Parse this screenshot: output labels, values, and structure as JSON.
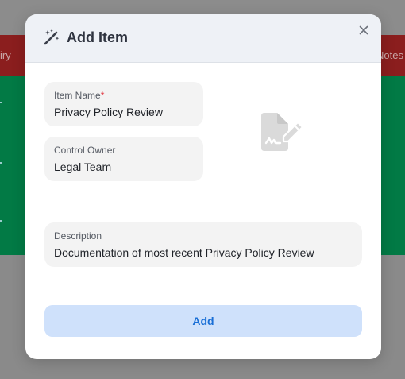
{
  "background": {
    "table_header_left": "iry",
    "table_header_right": "Notes"
  },
  "modal": {
    "title": "Add Item",
    "title_icon": "magic-wand-icon",
    "close_icon": "close-icon",
    "illustration_icon": "document-signature-icon",
    "fields": {
      "item_name": {
        "label": "Item Name",
        "required_mark": "*",
        "value": "Privacy Policy Review"
      },
      "control_owner": {
        "label": "Control Owner",
        "value": "Legal Team"
      },
      "description": {
        "label": "Description",
        "value": "Documentation of most recent Privacy Policy Review"
      }
    },
    "add_button_label": "Add",
    "colors": {
      "header_bg": "#eef1f6",
      "field_bg": "#f3f3f3",
      "button_bg": "#cfe1fb",
      "button_text": "#1a6fd6",
      "required": "#e0313b",
      "backdrop_red": "#8b1e1e",
      "backdrop_green": "#027a45"
    }
  }
}
